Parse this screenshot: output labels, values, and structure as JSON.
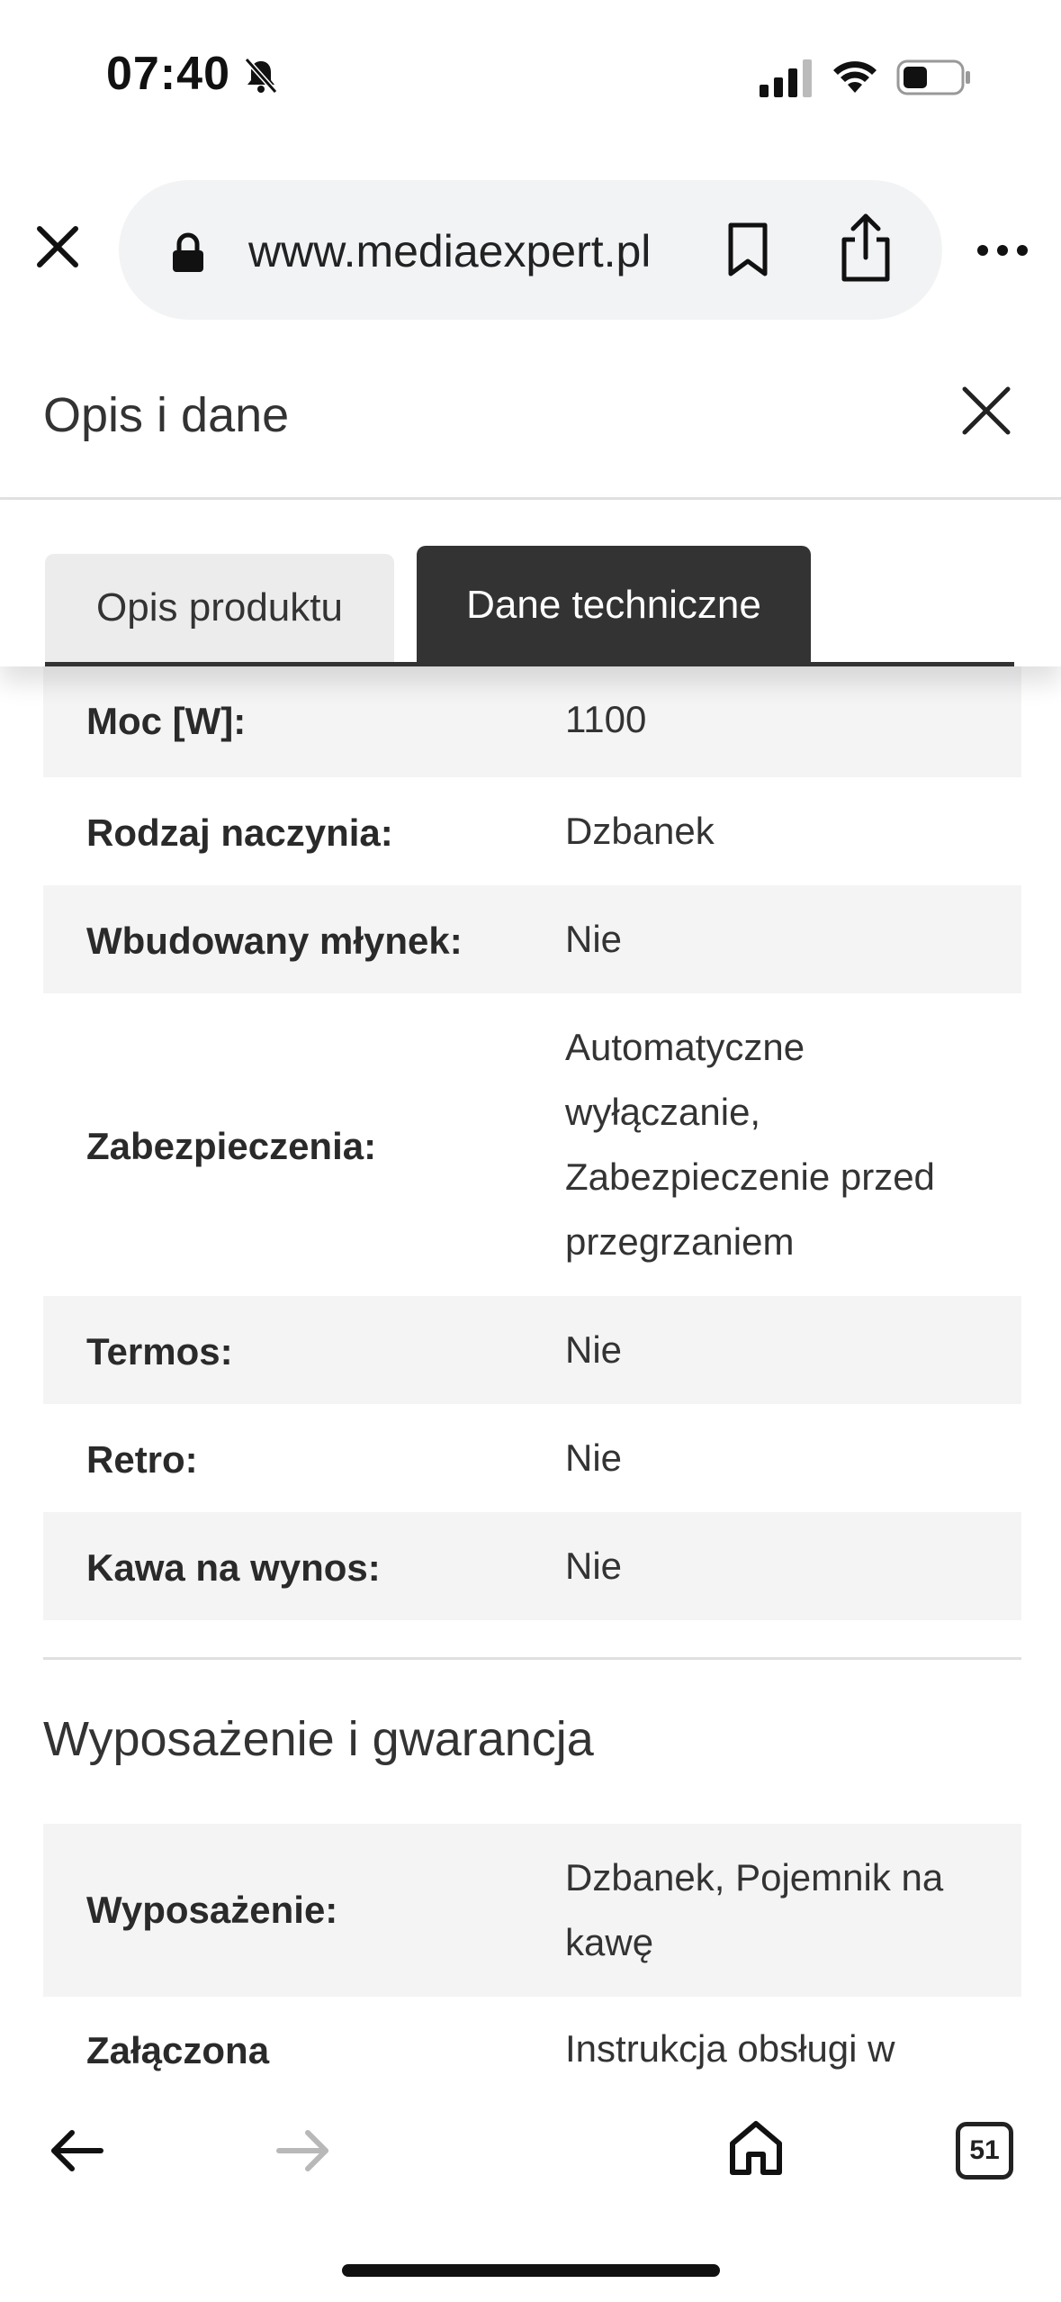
{
  "status_bar": {
    "time": "07:40"
  },
  "browser": {
    "url": "www.mediaexpert.pl"
  },
  "panel": {
    "title": "Opis i dane"
  },
  "tabs": [
    {
      "label": "Opis produktu",
      "active": false
    },
    {
      "label": "Dane techniczne",
      "active": true
    }
  ],
  "specs": [
    {
      "label": "Moc [W]:",
      "value": "1100"
    },
    {
      "label": "Rodzaj naczynia:",
      "value": "Dzbanek"
    },
    {
      "label": "Wbudowany młynek:",
      "value": "Nie"
    },
    {
      "label": "Zabezpieczenia:",
      "value_lines": [
        "Automatyczne",
        "wyłączanie,",
        "Zabezpieczenie przed",
        "przegrzaniem"
      ]
    },
    {
      "label": "Termos:",
      "value": "Nie"
    },
    {
      "label": "Retro:",
      "value": "Nie"
    },
    {
      "label": "Kawa na wynos:",
      "value": "Nie"
    }
  ],
  "section2": {
    "title": "Wyposażenie i gwarancja",
    "specs": [
      {
        "label": "Wyposażenie:",
        "value_lines": [
          "Dzbanek, Pojemnik na",
          "kawę"
        ]
      },
      {
        "label": "Załączona",
        "value": "Instrukcja obsługi w"
      }
    ]
  },
  "bottom_bar": {
    "tab_count": "51"
  }
}
